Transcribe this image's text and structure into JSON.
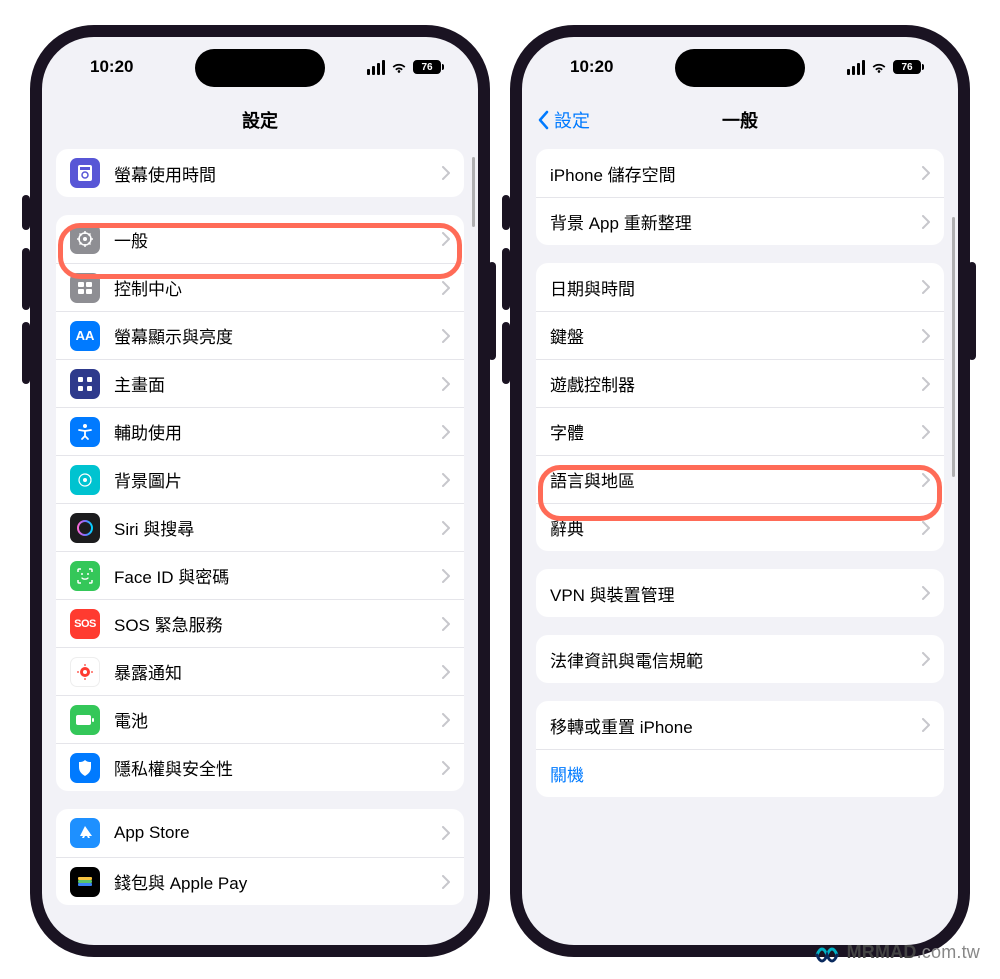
{
  "status": {
    "time": "10:20",
    "battery": "76"
  },
  "left_phone": {
    "title": "設定",
    "highlight_item": "一般",
    "groups": [
      {
        "items": [
          {
            "icon": "screentime",
            "name": "screen-time",
            "label": "螢幕使用時間"
          }
        ]
      },
      {
        "items": [
          {
            "icon": "general",
            "name": "general",
            "label": "一般"
          },
          {
            "icon": "control",
            "name": "control-center",
            "label": "控制中心"
          },
          {
            "icon": "display",
            "name": "display",
            "label": "螢幕顯示與亮度"
          },
          {
            "icon": "home",
            "name": "home-screen",
            "label": "主畫面"
          },
          {
            "icon": "access",
            "name": "accessibility",
            "label": "輔助使用"
          },
          {
            "icon": "wallpaper",
            "name": "wallpaper",
            "label": "背景圖片"
          },
          {
            "icon": "siri",
            "name": "siri-search",
            "label": "Siri 與搜尋"
          },
          {
            "icon": "faceid",
            "name": "faceid",
            "label": "Face ID 與密碼"
          },
          {
            "icon": "sos",
            "name": "sos",
            "label": "SOS 緊急服務"
          },
          {
            "icon": "exposure",
            "name": "exposure",
            "label": "暴露通知"
          },
          {
            "icon": "battery",
            "name": "battery",
            "label": "電池"
          },
          {
            "icon": "privacy",
            "name": "privacy",
            "label": "隱私權與安全性"
          }
        ]
      },
      {
        "items": [
          {
            "icon": "appstore",
            "name": "app-store",
            "label": "App Store"
          },
          {
            "icon": "wallet",
            "name": "wallet",
            "label": "錢包與 Apple Pay"
          }
        ]
      }
    ]
  },
  "right_phone": {
    "title": "一般",
    "back_label": "設定",
    "highlight_item": "字體",
    "groups": [
      {
        "items": [
          {
            "name": "iphone-storage",
            "label": "iPhone 儲存空間"
          },
          {
            "name": "background-refresh",
            "label": "背景 App 重新整理"
          }
        ]
      },
      {
        "items": [
          {
            "name": "date-time",
            "label": "日期與時間"
          },
          {
            "name": "keyboard",
            "label": "鍵盤"
          },
          {
            "name": "game-controller",
            "label": "遊戲控制器"
          },
          {
            "name": "fonts",
            "label": "字體"
          },
          {
            "name": "language-region",
            "label": "語言與地區"
          },
          {
            "name": "dictionary",
            "label": "辭典"
          }
        ]
      },
      {
        "items": [
          {
            "name": "vpn-device",
            "label": "VPN 與裝置管理"
          }
        ]
      },
      {
        "items": [
          {
            "name": "legal",
            "label": "法律資訊與電信規範"
          }
        ]
      },
      {
        "items": [
          {
            "name": "transfer-reset",
            "label": "移轉或重置 iPhone"
          },
          {
            "name": "shutdown",
            "label": "關機",
            "link": true,
            "no_chevron": true
          }
        ]
      }
    ]
  },
  "watermark": {
    "brand": "MRMAD",
    "suffix": ".com.tw"
  }
}
